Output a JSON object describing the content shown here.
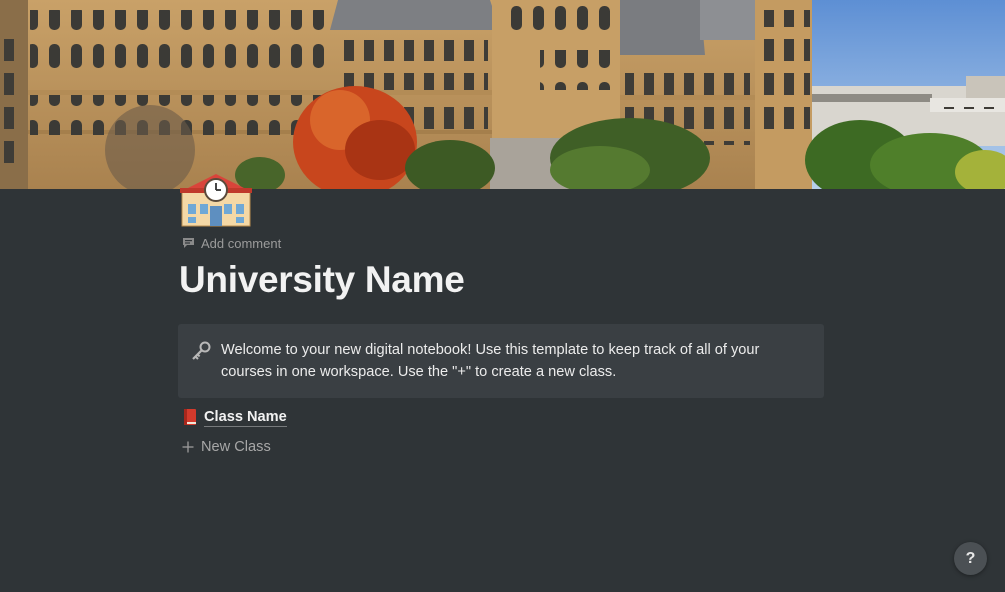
{
  "cover": {
    "description_icon": "university-building-photo"
  },
  "page": {
    "icon": "school-clock-emoji",
    "add_comment_label": "Add comment",
    "title": "University Name"
  },
  "callout": {
    "icon": "key-icon",
    "text": "Welcome to your new digital notebook! Use this template to keep track of all of your courses in one workspace. Use the \"+\" to create a new class."
  },
  "classes": [
    {
      "icon": "red-book-icon",
      "label": "Class Name"
    }
  ],
  "new_class_label": "New Class",
  "help_label": "?",
  "colors": {
    "background": "#2f3437",
    "callout_background": "#3a3f43",
    "muted_text": "#9b9b9b"
  }
}
